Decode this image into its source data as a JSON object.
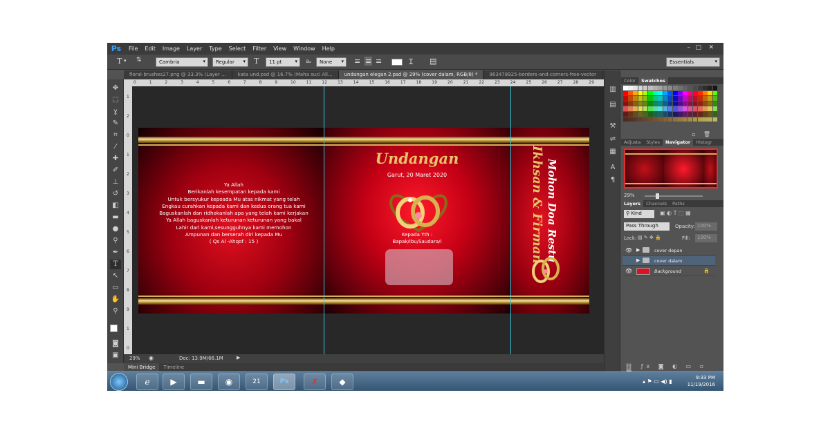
{
  "app": {
    "logo": "Ps"
  },
  "menu": [
    "File",
    "Edit",
    "Image",
    "Layer",
    "Type",
    "Select",
    "Filter",
    "View",
    "Window",
    "Help"
  ],
  "window_controls": {
    "minimize": "–",
    "restore": "□",
    "close": "✕"
  },
  "options": {
    "tool_glyph": "T",
    "font_family": "Cambria",
    "font_style": "Regular",
    "font_size": "11 pt",
    "antialias": "None",
    "workspace": "Essentials"
  },
  "doc_tabs": [
    {
      "label": "floral-brushes27.png @ 33.3% (Layer ...",
      "active": false
    },
    {
      "label": "kata und.psd @ 16.7% (Maha suci All...",
      "active": false
    },
    {
      "label": "undangan elegan 2.psd @ 29% (cover dalam, RGB/8) *",
      "active": true
    },
    {
      "label": "963478925-borders-and-corners-free-vector",
      "active": false
    }
  ],
  "ruler": {
    "h_ticks": [
      "0",
      "1",
      "2",
      "3",
      "4",
      "5",
      "6",
      "7",
      "8",
      "9",
      "10",
      "11",
      "12",
      "13",
      "14",
      "15",
      "16",
      "17",
      "18",
      "19",
      "20",
      "21",
      "22",
      "23",
      "24",
      "25",
      "26",
      "27",
      "28",
      "29"
    ],
    "v_ticks": [
      "1",
      "2",
      "0",
      "1",
      "2",
      "3",
      "4",
      "5",
      "6",
      "7",
      "8",
      "9",
      "1",
      "0"
    ]
  },
  "document": {
    "prayer": {
      "heading": "Ya Allah",
      "lines": [
        "Berikanlah kesempatan kepada kami",
        "Untuk bersyukur kepoada Mu atas nikmat yang telah",
        "Engkau curahkan kepada kami dan kedua orang tua kami",
        "Baguskanlah dan ridhokanlah apa yang telah kami kerjakan",
        "Ya Allah baguskanlah keturunan keturunan yang bakal",
        "Lahir dari kami,sesungguhnya kami memohon",
        "Ampunan dan berserah diri kepada Mu",
        "( Qs Al -Ahqof : 15 )"
      ]
    },
    "title": "Undangan",
    "date": "Garut, 20 Maret 2020",
    "kepada_line1": "Kepada Yth :",
    "kepada_line2": "Bapak/Ibu/Saudara/i",
    "spine_names": "Ikhsan & Firman",
    "spine_subtitle": "Mohon Doa Restu"
  },
  "status": {
    "zoom": "29%",
    "doc_size": "Doc: 13.9M/66.1M"
  },
  "bottom_tabs": [
    {
      "label": "Mini Bridge",
      "active": true
    },
    {
      "label": "Timeline",
      "active": false
    }
  ],
  "color_panel": {
    "tabs": [
      {
        "label": "Color",
        "active": false
      },
      {
        "label": "Swatches",
        "active": true
      }
    ]
  },
  "nav_panel": {
    "tabs": [
      {
        "label": "Adjusta",
        "active": false
      },
      {
        "label": "Styles",
        "active": false
      },
      {
        "label": "Navigator",
        "active": true
      },
      {
        "label": "Histogr",
        "active": false
      }
    ],
    "zoom": "29%"
  },
  "layers_panel": {
    "tabs": [
      {
        "label": "Layers",
        "active": true
      },
      {
        "label": "Channels",
        "active": false
      },
      {
        "label": "Paths",
        "active": false
      }
    ],
    "filter": "Kind",
    "blend": "Pass Through",
    "opacity_label": "Opacity:",
    "opacity": "100%",
    "lock_label": "Lock:",
    "fill_label": "Fill:",
    "fill": "100%",
    "layers": [
      {
        "name": "cover depan",
        "type": "group",
        "visible": true,
        "selected": false
      },
      {
        "name": "cover dalam",
        "type": "group",
        "visible": false,
        "selected": true
      },
      {
        "name": "Background",
        "type": "pixel",
        "visible": true,
        "selected": false
      }
    ]
  },
  "taskbar": {
    "time": "9:33 PM",
    "date": "11/19/2016",
    "calendar_num": "21"
  },
  "colors": {
    "accent_gold": "#e6c46a",
    "bg_red": "#c40015",
    "ps_blue": "#3aa0ff",
    "selection": "#4f6379"
  }
}
